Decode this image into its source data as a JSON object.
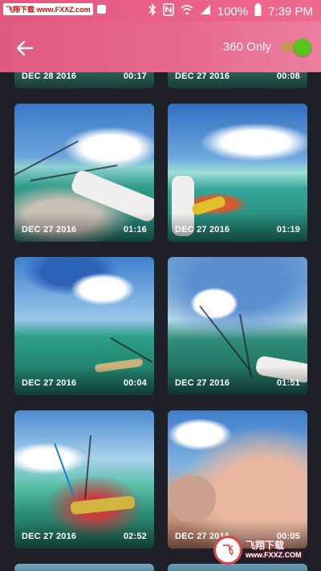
{
  "status_bar": {
    "watermark": "飞翔下载 www.FXXZ.com",
    "battery": "100%",
    "time": "7:39 PM",
    "icons": [
      "bluetooth-icon",
      "nfc-icon",
      "wifi-icon",
      "signal-icon",
      "battery-icon"
    ]
  },
  "app_bar": {
    "back_icon": "arrow-left-icon",
    "toggle_label": "360 Only",
    "toggle_on": true,
    "accent_color": "#55c41c"
  },
  "grid": {
    "items": [
      {
        "date": "DEC 28 2016",
        "duration": "00:17"
      },
      {
        "date": "DEC 27 2016",
        "duration": "00:08"
      },
      {
        "date": "DEC 27 2016",
        "duration": "01:16"
      },
      {
        "date": "DEC 27 2016",
        "duration": "01:19"
      },
      {
        "date": "DEC 27 2016",
        "duration": "00:04"
      },
      {
        "date": "DEC 27 2016",
        "duration": "01:51"
      },
      {
        "date": "DEC 27 2016",
        "duration": "02:52"
      },
      {
        "date": "DEC 27 2016",
        "duration": "00:05"
      }
    ]
  },
  "watermark_badge": {
    "logo_text": "飞",
    "line1": "飞翔下载",
    "line2": "www.FXXZ.COM"
  }
}
